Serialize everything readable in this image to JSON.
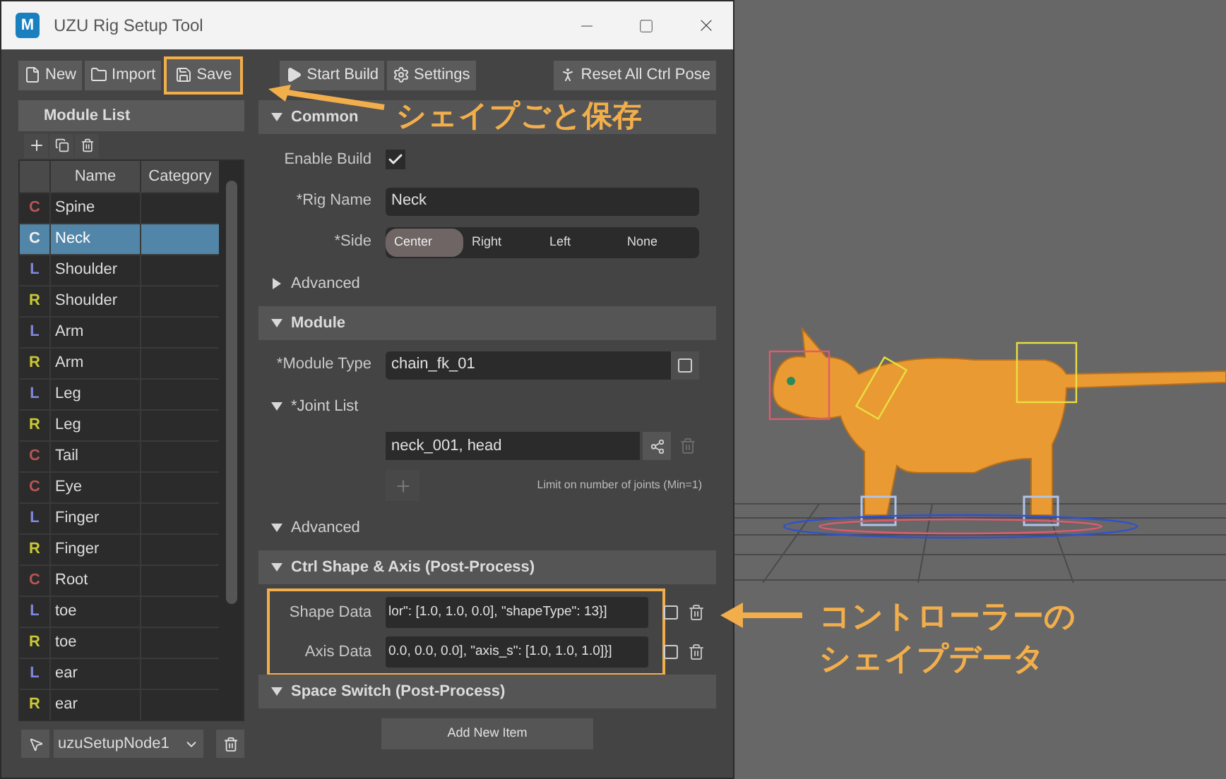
{
  "window": {
    "title": "UZU Rig Setup Tool",
    "app_badge": "M"
  },
  "toolbar": [
    {
      "kind": "new",
      "label": "New",
      "highlighted": false
    },
    {
      "kind": "import",
      "label": "Import",
      "highlighted": false
    },
    {
      "kind": "save",
      "label": "Save",
      "highlighted": true
    },
    {
      "kind": "build",
      "label": "Start Build",
      "highlighted": false
    },
    {
      "kind": "settings",
      "label": "Settings",
      "highlighted": false
    },
    {
      "kind": "reset",
      "label": "Reset All Ctrl Pose",
      "highlighted": false
    }
  ],
  "module_list": {
    "title": "Module List",
    "columns": [
      "Name",
      "Category"
    ],
    "rows": [
      {
        "side": "C",
        "color": "#b85555",
        "name": "Spine",
        "selected": false
      },
      {
        "side": "C",
        "color": "#f0f0f0",
        "name": "Neck",
        "selected": true
      },
      {
        "side": "L",
        "color": "#7f89dc",
        "name": "Shoulder",
        "selected": false
      },
      {
        "side": "R",
        "color": "#c9c935",
        "name": "Shoulder",
        "selected": false
      },
      {
        "side": "L",
        "color": "#7f89dc",
        "name": "Arm",
        "selected": false
      },
      {
        "side": "R",
        "color": "#c9c935",
        "name": "Arm",
        "selected": false
      },
      {
        "side": "L",
        "color": "#7f89dc",
        "name": "Leg",
        "selected": false
      },
      {
        "side": "R",
        "color": "#c9c935",
        "name": "Leg",
        "selected": false
      },
      {
        "side": "C",
        "color": "#b85555",
        "name": "Tail",
        "selected": false
      },
      {
        "side": "C",
        "color": "#b85555",
        "name": "Eye",
        "selected": false
      },
      {
        "side": "L",
        "color": "#7f89dc",
        "name": "Finger",
        "selected": false
      },
      {
        "side": "R",
        "color": "#c9c935",
        "name": "Finger",
        "selected": false
      },
      {
        "side": "C",
        "color": "#b85555",
        "name": "Root",
        "selected": false
      },
      {
        "side": "L",
        "color": "#7f89dc",
        "name": "toe",
        "selected": false
      },
      {
        "side": "R",
        "color": "#c9c935",
        "name": "toe",
        "selected": false
      },
      {
        "side": "L",
        "color": "#7f89dc",
        "name": "ear",
        "selected": false
      },
      {
        "side": "R",
        "color": "#c9c935",
        "name": "ear",
        "selected": false
      }
    ],
    "node": "uzuSetupNode1"
  },
  "sections": [
    {
      "title": "Common",
      "expanded": true,
      "items": [
        {
          "kind": "checkbox",
          "label": "Enable Build",
          "checked": true
        },
        {
          "kind": "text",
          "label": "*Rig Name",
          "value": "Neck"
        },
        {
          "kind": "segmented",
          "label": "*Side",
          "options": [
            {
              "label": "Center",
              "selected": true
            },
            {
              "label": "Right",
              "selected": false
            },
            {
              "label": "Left",
              "selected": false
            },
            {
              "label": "None",
              "selected": false
            }
          ]
        },
        {
          "kind": "subsection",
          "title": "Advanced",
          "expanded": false
        }
      ]
    },
    {
      "title": "Module",
      "expanded": true,
      "items": [
        {
          "kind": "browse",
          "label": "*Module Type",
          "value": "chain_fk_01"
        },
        {
          "kind": "subsection",
          "title": "*Joint List",
          "expanded": true
        },
        {
          "kind": "joints",
          "value": "neck_001, head",
          "hint": "Limit on number of joints (Min=1)"
        },
        {
          "kind": "subsection",
          "title": "Advanced",
          "expanded": true
        }
      ]
    },
    {
      "title": "Ctrl Shape & Axis (Post-Process)",
      "expanded": true,
      "highlighted": true,
      "items": [
        {
          "kind": "data",
          "label": "Shape Data",
          "value": "lor\": [1.0, 1.0, 0.0], \"shapeType\": 13}]"
        },
        {
          "kind": "data",
          "label": "Axis Data",
          "value": "0.0, 0.0, 0.0], \"axis_s\": [1.0, 1.0, 1.0]}]"
        }
      ]
    },
    {
      "title": "Space Switch (Post-Process)",
      "expanded": true,
      "items": [
        {
          "kind": "button",
          "label": "Add New Item"
        }
      ]
    }
  ],
  "annotations": [
    {
      "kind": "save",
      "lines": [
        "シェイプごと保存"
      ]
    },
    {
      "kind": "shape",
      "lines": [
        "コントローラーの",
        "シェイプデータ"
      ]
    }
  ]
}
